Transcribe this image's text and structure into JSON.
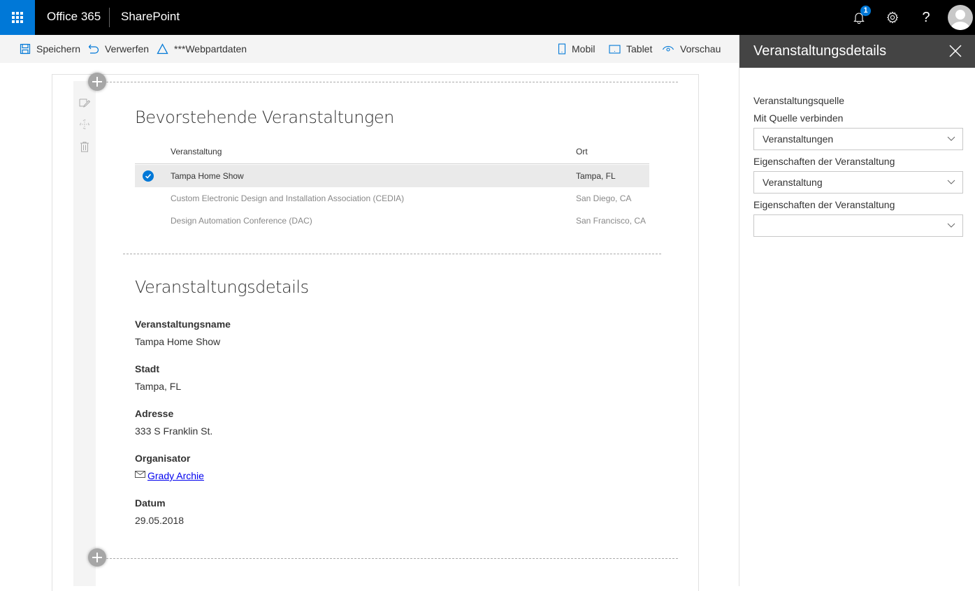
{
  "suitebar": {
    "brand": "Office 365",
    "app": "SharePoint",
    "notification_count": "1",
    "help_label": "?"
  },
  "commandbar": {
    "save": "Speichern",
    "discard": "Verwerfen",
    "webpart_data": "***Webpartdaten",
    "mobile": "Mobil",
    "tablet": "Tablet",
    "preview": "Vorschau"
  },
  "events_webpart": {
    "title": "Bevorstehende Veranstaltungen",
    "columns": {
      "name": "Veranstaltung",
      "location": "Ort"
    },
    "rows": [
      {
        "name": "Tampa Home Show",
        "location": "Tampa, FL",
        "selected": true
      },
      {
        "name": "Custom Electronic Design and Installation Association (CEDIA)",
        "location": "San Diego, CA",
        "selected": false
      },
      {
        "name": "Design Automation Conference (DAC)",
        "location": "San Francisco, CA",
        "selected": false
      }
    ]
  },
  "details_webpart": {
    "title": "Veranstaltungsdetails",
    "fields": [
      {
        "label": "Veranstaltungsname",
        "value": "Tampa Home Show"
      },
      {
        "label": "Stadt",
        "value": "Tampa, FL"
      },
      {
        "label": "Adresse",
        "value": "333 S Franklin St."
      },
      {
        "label": "Organisator",
        "value": "Grady Archie"
      },
      {
        "label": "Datum",
        "value": "29.05.2018"
      }
    ]
  },
  "panel": {
    "title": "Veranstaltungsdetails",
    "group_label": "Veranstaltungsquelle",
    "fields": [
      {
        "label": "Mit Quelle verbinden",
        "value": "Veranstaltungen"
      },
      {
        "label": "Eigenschaften der Veranstaltung",
        "value": "Veranstaltung"
      },
      {
        "label": "Eigenschaften der Veranstaltung",
        "value": ""
      }
    ]
  },
  "colors": {
    "accent": "#0078d7",
    "suitebar": "#000000",
    "panel_header": "#444444"
  }
}
